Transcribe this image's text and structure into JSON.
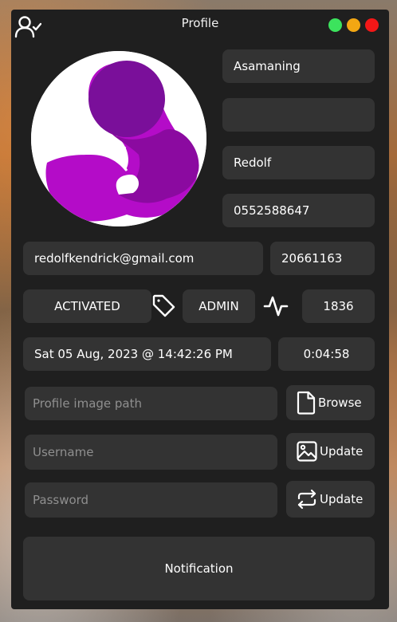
{
  "window": {
    "title": "Profile"
  },
  "profile": {
    "first_name": "Asamaning",
    "middle_name": "",
    "last_name": "Redolf",
    "phone": "0552588647",
    "email": "redolfkendrick@gmail.com",
    "id_number": "20661163",
    "status": "ACTIVATED",
    "role": "ADMIN",
    "activity_count": "1836",
    "datetime": "Sat 05 Aug, 2023 @ 14:42:26 PM",
    "session_time": "0:04:58"
  },
  "form": {
    "image_path_placeholder": "Profile image path",
    "username_placeholder": "Username",
    "password_placeholder": "Password",
    "browse_label": "Browse",
    "update_username_label": "Update",
    "update_password_label": "Update"
  },
  "notification": {
    "label": "Notification"
  },
  "colors": {
    "window_bg": "#1f1f1f",
    "field_bg": "#333333",
    "avatar_purple": "#a40cb0",
    "dot_green": "#3ce35d",
    "dot_orange": "#f3a713",
    "dot_red": "#f31717"
  },
  "icons": [
    "user-check-icon",
    "tag-icon",
    "activity-icon",
    "file-icon",
    "image-icon",
    "repeat-icon"
  ]
}
